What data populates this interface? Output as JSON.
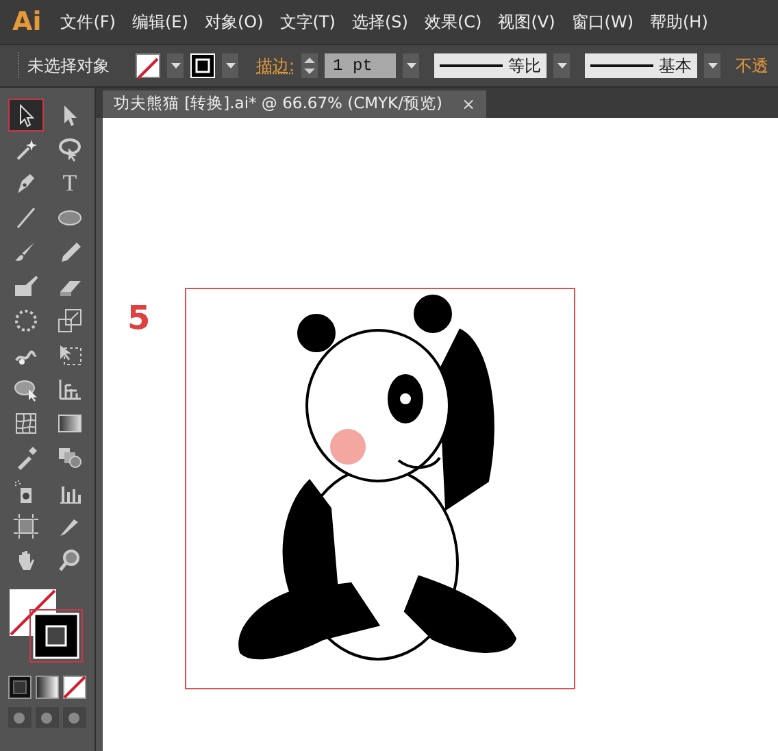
{
  "app": {
    "logo": "Ai"
  },
  "menu": [
    "文件(F)",
    "编辑(E)",
    "对象(O)",
    "文字(T)",
    "选择(S)",
    "效果(C)",
    "视图(V)",
    "窗口(W)",
    "帮助(H)"
  ],
  "control_bar": {
    "selection": "未选择对象",
    "stroke_label": "描边:",
    "stroke_weight": "1 pt",
    "variable_width": "等比",
    "brush": "基本",
    "opacity_label": "不透"
  },
  "document_tab": {
    "title": "功夫熊猫  [转换].ai* @ 66.67% (CMYK/预览)",
    "close": "×"
  },
  "tools": [
    {
      "kind": "arrow",
      "selected": true
    },
    {
      "kind": "white-arrow",
      "selected": false
    },
    {
      "kind": "wand",
      "selected": false
    },
    {
      "kind": "lasso",
      "selected": false
    },
    {
      "kind": "pen",
      "selected": false
    },
    {
      "kind": "type",
      "label": "T",
      "selected": false
    },
    {
      "kind": "line",
      "selected": false
    },
    {
      "kind": "ellipse",
      "selected": false
    },
    {
      "kind": "brush",
      "selected": false
    },
    {
      "kind": "pencil",
      "selected": false
    },
    {
      "kind": "blob",
      "selected": false
    },
    {
      "kind": "eraser",
      "selected": false
    },
    {
      "kind": "rotate",
      "selected": false
    },
    {
      "kind": "scale",
      "selected": false
    },
    {
      "kind": "warp",
      "selected": false
    },
    {
      "kind": "transform",
      "selected": false
    },
    {
      "kind": "builder",
      "selected": false
    },
    {
      "kind": "perspective",
      "selected": false
    },
    {
      "kind": "mesh",
      "selected": false
    },
    {
      "kind": "gradient",
      "selected": false
    },
    {
      "kind": "eyedropper",
      "selected": false
    },
    {
      "kind": "blend",
      "selected": false
    },
    {
      "kind": "spray",
      "selected": false
    },
    {
      "kind": "chart",
      "selected": false
    },
    {
      "kind": "artboard",
      "selected": false
    },
    {
      "kind": "slice",
      "selected": false
    },
    {
      "kind": "hand",
      "selected": false
    },
    {
      "kind": "zoom",
      "selected": false
    }
  ],
  "canvas": {
    "step": "5"
  }
}
